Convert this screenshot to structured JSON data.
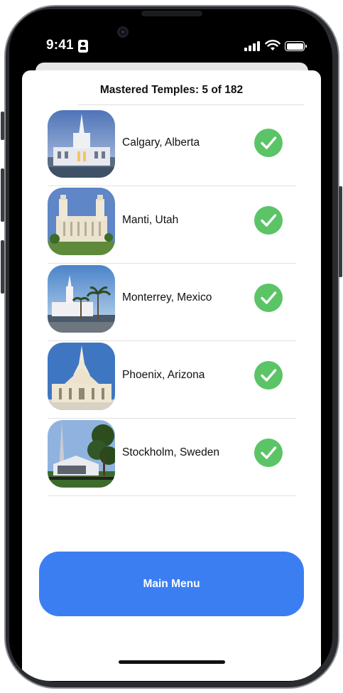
{
  "status_bar": {
    "time": "9:41",
    "badge_icon": "id-badge-icon",
    "signal_icon": "cellular-signal-icon",
    "wifi_icon": "wifi-icon",
    "battery_icon": "battery-full-icon"
  },
  "sheet": {
    "title": "Mastered Temples: 5 of 182",
    "temples": [
      {
        "name": "Calgary, Alberta",
        "mastered": true,
        "photo": "calgary-temple-photo"
      },
      {
        "name": "Manti, Utah",
        "mastered": true,
        "photo": "manti-temple-photo"
      },
      {
        "name": "Monterrey, Mexico",
        "mastered": true,
        "photo": "monterrey-temple-photo"
      },
      {
        "name": "Phoenix, Arizona",
        "mastered": true,
        "photo": "phoenix-temple-photo"
      },
      {
        "name": "Stockholm, Sweden",
        "mastered": true,
        "photo": "stockholm-temple-photo"
      }
    ]
  },
  "main_menu_button": {
    "label": "Main Menu"
  },
  "colors": {
    "accent_blue": "#3b7ef2",
    "check_green": "#5bc466",
    "device_frame": "#2a2c30"
  }
}
